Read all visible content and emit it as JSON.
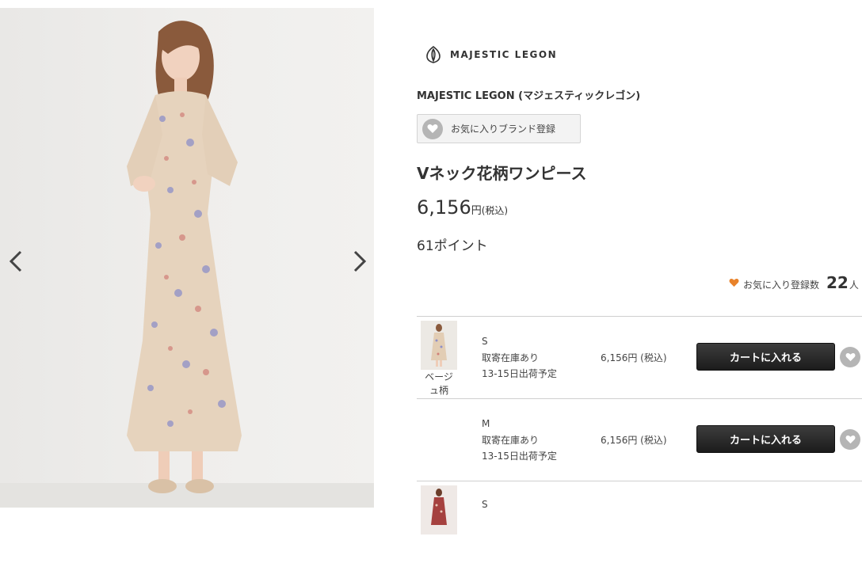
{
  "gallery": {
    "prev_icon": "chevron-left-icon",
    "next_icon": "chevron-right-icon"
  },
  "brand": {
    "logo_text": "MAJESTIC LEGON",
    "name": "MAJESTIC LEGON (マジェスティックレゴン)",
    "fav_button_label": "お気に入りブランド登録"
  },
  "product": {
    "title": "Vネック花柄ワンピース",
    "price": "6,156",
    "price_unit": "円",
    "price_tax": "(税込)",
    "points": "61ポイント"
  },
  "favorites": {
    "label": "お気に入り登録数",
    "count": "22",
    "unit": "人"
  },
  "skus": [
    {
      "color": "ベージュ柄",
      "size": "S",
      "stock": "取寄在庫あり",
      "ship": "13-15日出荷予定",
      "price": "6,156円 (税込)",
      "cart_label": "カートに入れる"
    },
    {
      "color": "",
      "size": "M",
      "stock": "取寄在庫あり",
      "ship": "13-15日出荷予定",
      "price": "6,156円 (税込)",
      "cart_label": "カートに入れる"
    },
    {
      "color": "",
      "size": "S",
      "stock": "",
      "ship": "",
      "price": "",
      "cart_label": ""
    }
  ],
  "colors": {
    "heart_orange": "#e8822a",
    "heart_gray": "#b5b5b5",
    "cart_button": "#2b2b2b"
  }
}
